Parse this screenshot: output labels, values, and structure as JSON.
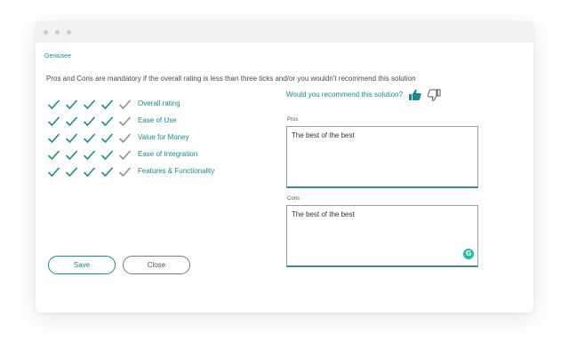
{
  "app": {
    "brand": "Geniusee"
  },
  "notice": "Pros and Cons are mandatory if the overall rating is less than three ticks and/or you wouldn't recommend this solution",
  "ratings": [
    {
      "label": "Overall rating",
      "ticks": 4,
      "max": 5
    },
    {
      "label": "Ease of Use",
      "ticks": 4,
      "max": 5
    },
    {
      "label": "Value for Money",
      "ticks": 4,
      "max": 5
    },
    {
      "label": "Ease of Integration",
      "ticks": 4,
      "max": 5
    },
    {
      "label": "Features & Functionality",
      "ticks": 4,
      "max": 5
    }
  ],
  "recommend": {
    "question": "Would you recommend this solution?",
    "selected": "yes",
    "thumb_up_icon": "thumbs-up-icon",
    "thumb_down_icon": "thumbs-down-icon"
  },
  "pros": {
    "label": "Pros",
    "value": "The best of the best"
  },
  "cons": {
    "label": "Cons",
    "value": "The best of the best"
  },
  "buttons": {
    "save": "Save",
    "close": "Close"
  },
  "colors": {
    "accent": "#1a8a91",
    "tick_active": "#1a8a91",
    "tick_inactive": "#8c9196",
    "grammarly": "#15c39a"
  }
}
